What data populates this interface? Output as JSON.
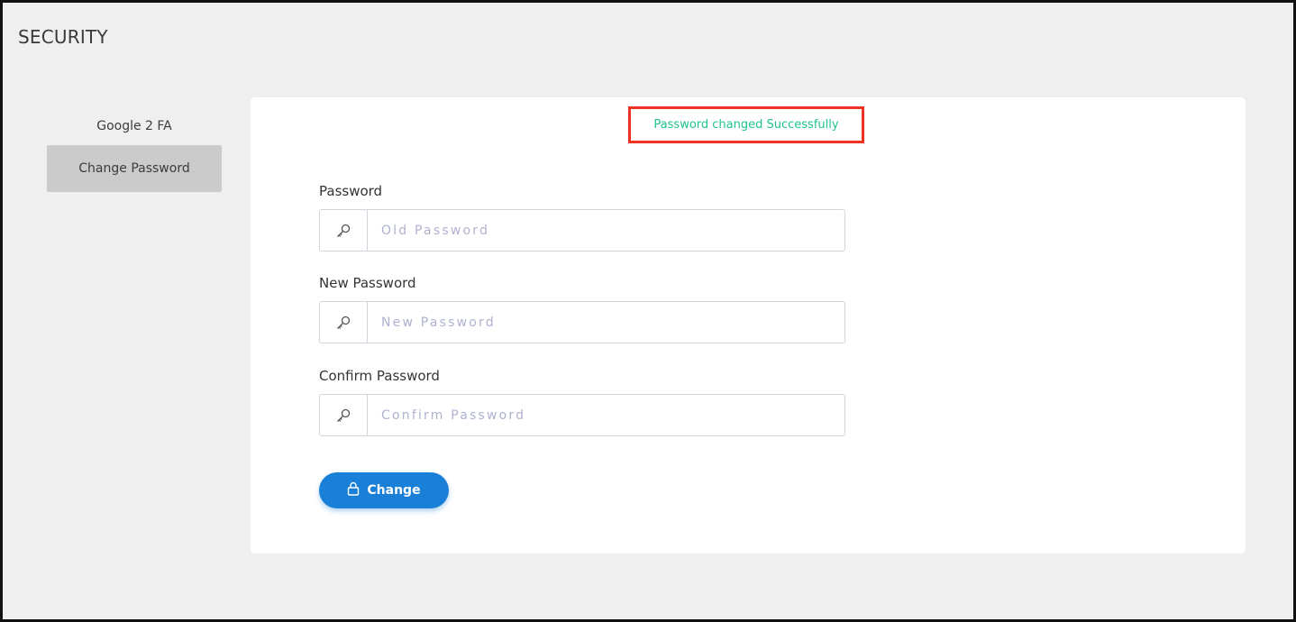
{
  "header": {
    "title": "SECURITY"
  },
  "sidebar": {
    "items": [
      {
        "label": "Google 2 FA",
        "active": false
      },
      {
        "label": "Change Password",
        "active": true
      }
    ]
  },
  "form": {
    "success_message": "Password changed Successfully",
    "fields": [
      {
        "label": "Password",
        "placeholder": "Old Password",
        "value": "",
        "icon": "key-icon"
      },
      {
        "label": "New Password",
        "placeholder": "New Password",
        "value": "",
        "icon": "key-icon"
      },
      {
        "label": "Confirm Password",
        "placeholder": "Confirm Password",
        "value": "",
        "icon": "key-icon"
      }
    ],
    "submit": {
      "label": "Change",
      "icon": "lock-icon"
    }
  },
  "colors": {
    "success_text": "#1fc48a",
    "highlight_border": "#ef3322",
    "primary_button": "#1a7fd6",
    "active_sidebar": "#cbcbcb"
  }
}
